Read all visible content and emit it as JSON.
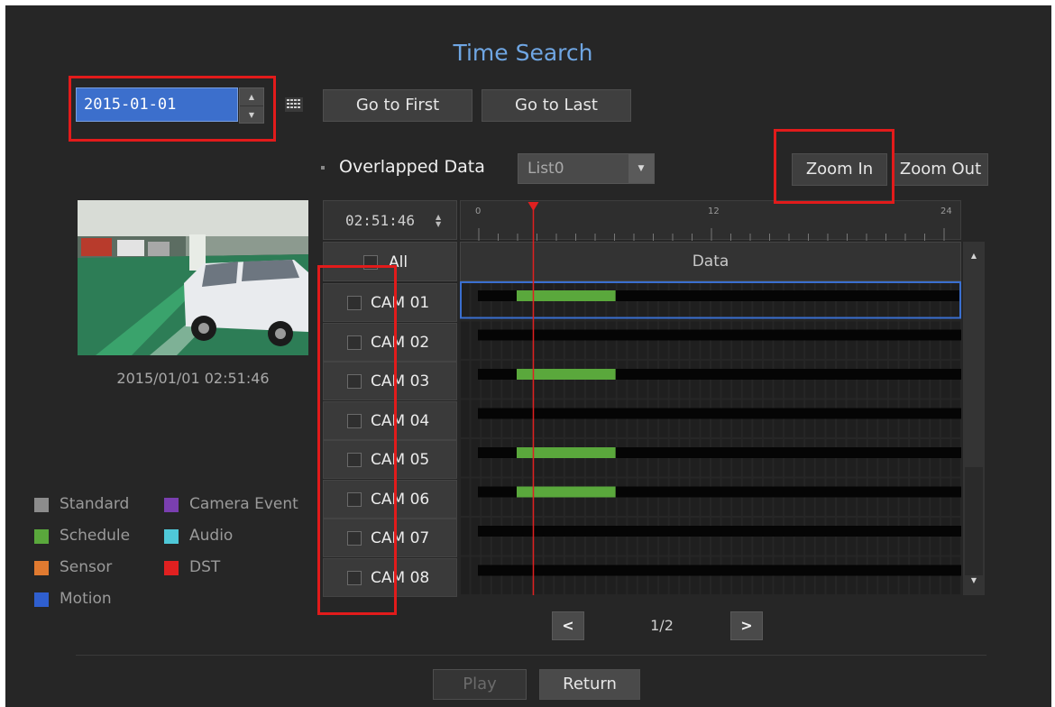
{
  "title": "Time Search",
  "date": {
    "value": "2015-01-01",
    "up_icon": "arrow-up",
    "down_icon": "arrow-down"
  },
  "calendar_icon": "calendar-icon",
  "toolbar": {
    "go_first": "Go to First",
    "go_last": "Go to Last",
    "zoom_in": "Zoom In",
    "zoom_out": "Zoom Out"
  },
  "overlap": {
    "label": "Overlapped Data",
    "selected": "List0"
  },
  "preview": {
    "timestamp": "2015/01/01 02:51:46"
  },
  "timeline": {
    "time": "02:51:46",
    "ruler_labels": [
      "0",
      "12",
      "24"
    ],
    "ruler_hours": [
      0,
      12,
      24
    ],
    "cursor_hour": 2.86,
    "column_header": "Data",
    "all_label": "All"
  },
  "cameras": [
    {
      "label": "CAM 01",
      "bar": [
        2,
        7.1
      ],
      "selected": true
    },
    {
      "label": "CAM 02",
      "bar": null,
      "selected": false
    },
    {
      "label": "CAM 03",
      "bar": [
        2,
        7.1
      ],
      "selected": false
    },
    {
      "label": "CAM 04",
      "bar": null,
      "selected": false
    },
    {
      "label": "CAM 05",
      "bar": [
        2,
        7.1
      ],
      "selected": false
    },
    {
      "label": "CAM 06",
      "bar": [
        2,
        7.1
      ],
      "selected": false
    },
    {
      "label": "CAM 07",
      "bar": null,
      "selected": false
    },
    {
      "label": "CAM 08",
      "bar": null,
      "selected": false
    }
  ],
  "legend": [
    {
      "label": "Standard",
      "color": "#8c8c8c"
    },
    {
      "label": "Camera Event",
      "color": "#7a3fb0"
    },
    {
      "label": "Schedule",
      "color": "#5aa83c"
    },
    {
      "label": "Audio",
      "color": "#4fc8d8"
    },
    {
      "label": "Sensor",
      "color": "#e07a30"
    },
    {
      "label": "DST",
      "color": "#e02020"
    },
    {
      "label": "Motion",
      "color": "#2f5fcf"
    }
  ],
  "pagination": {
    "current": "1/2",
    "prev_icon": "chevron-left-icon",
    "next_icon": "chevron-right-icon"
  },
  "footer": {
    "play": "Play",
    "return": "Return"
  },
  "colors": {
    "accent_title": "#6fa6e3",
    "bar": "#5aa83c",
    "cursor": "#e02020",
    "highlight": "#e21b1b"
  }
}
